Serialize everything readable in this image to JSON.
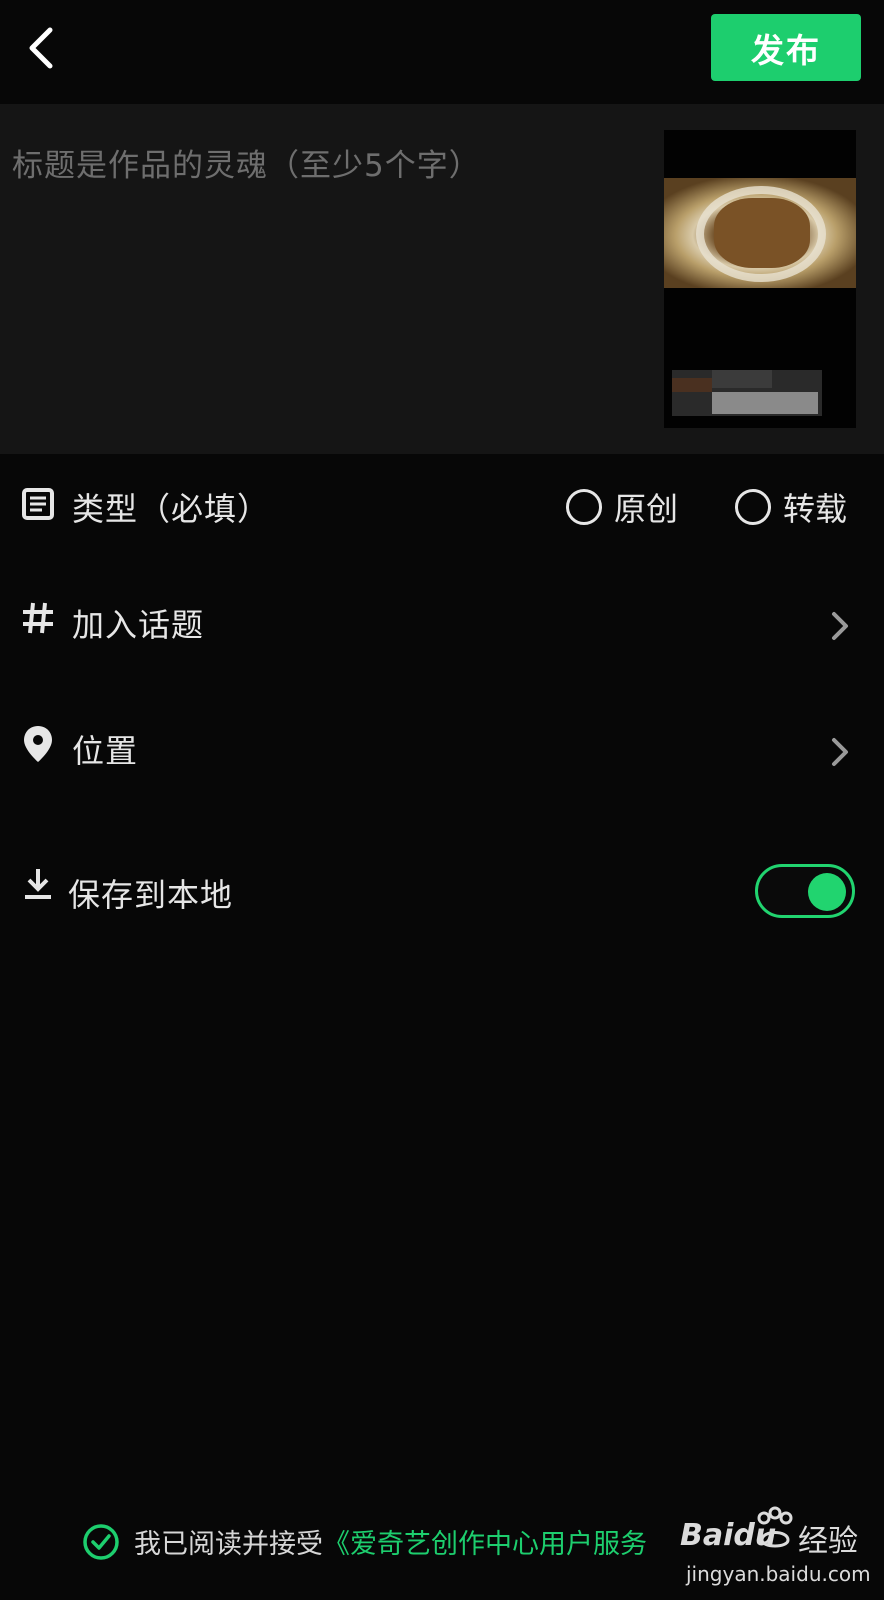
{
  "topbar": {
    "back_icon": "chevron-left-icon",
    "publish_label": "发布",
    "accent": "#1dce6e"
  },
  "title_area": {
    "placeholder": "标题是作品的灵魂（至少5个字）",
    "cover_image": "video-cover-thumbnail"
  },
  "rows": {
    "type": {
      "icon": "list-doc-icon",
      "label": "类型（必填）",
      "options": [
        {
          "label": "原创",
          "selected": false
        },
        {
          "label": "转载",
          "selected": false
        }
      ]
    },
    "topic": {
      "icon": "hashtag-icon",
      "label": "加入话题"
    },
    "location": {
      "icon": "location-pin-icon",
      "label": "位置"
    },
    "save_local": {
      "icon": "download-icon",
      "label": "保存到本地",
      "enabled": true
    }
  },
  "agreement": {
    "checked": true,
    "prefix": "我已阅读并接受",
    "link": "《爱奇艺创作中心用户服务"
  },
  "watermark": {
    "brand": "Baidu",
    "suffix": "经验",
    "url": "jingyan.baidu.com"
  }
}
